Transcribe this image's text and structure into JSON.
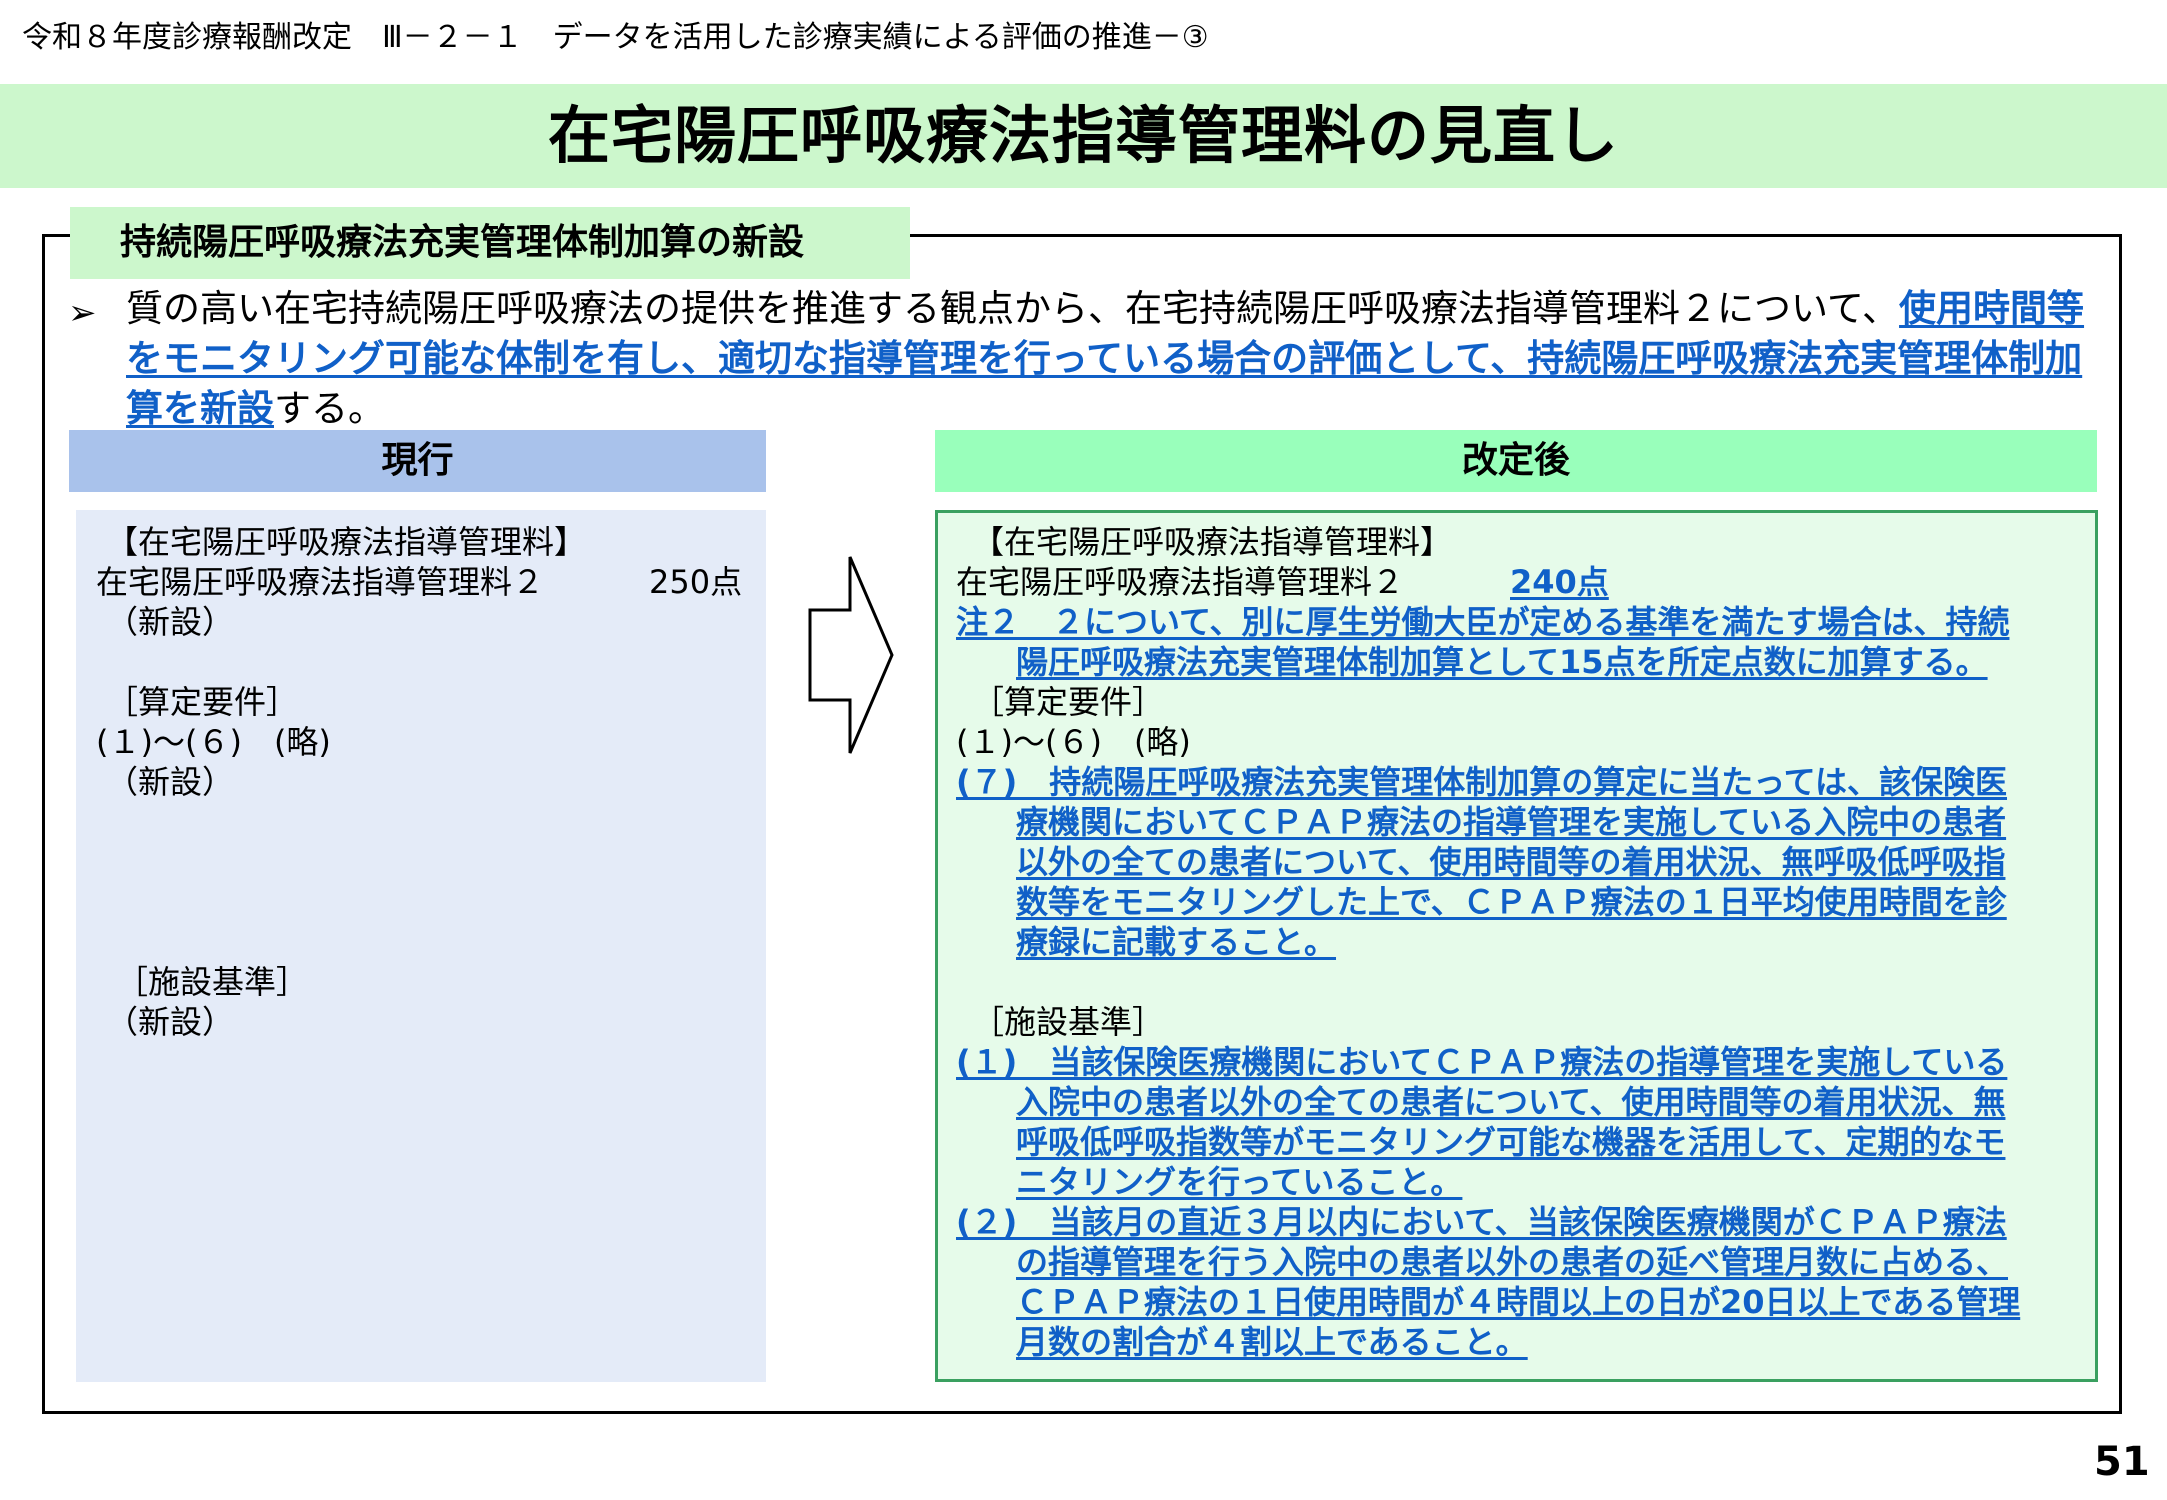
{
  "header": "令和８年度診療報酬改定　Ⅲ－２－１　データを活用した診療実績による評価の推進－③",
  "title": "在宅陽圧呼吸療法指導管理料の見直し",
  "section_title": "持続陽圧呼吸療法充実管理体制加算の新設",
  "summary": {
    "bullet": "➢",
    "text_before": "質の高い在宅持続陽圧呼吸療法の提供を推進する観点から、在宅持続陽圧呼吸療法指導管理料２について、",
    "highlight": "使用時間等をモニタリング可能な体制を有し、適切な指導管理を行っている場合の評価として、持続陽圧呼吸療法充実管理体制加算を新設",
    "text_after": "する。"
  },
  "current": {
    "heading": "現行",
    "lines": {
      "l1": "【在宅陽圧呼吸療法指導管理料】",
      "l2": "在宅陽圧呼吸療法指導管理料２",
      "l2_points": "250点",
      "l3": "（新設）",
      "l4": "［算定要件］",
      "l5": "(１)～(６)　(略)",
      "l6": "（新設）",
      "l7": "［施設基準］",
      "l8": "（新設）"
    }
  },
  "revised": {
    "heading": "改定後",
    "l1": "【在宅陽圧呼吸療法指導管理料】",
    "l2": "在宅陽圧呼吸療法指導管理料２",
    "l2_points": "240点",
    "note2_a": "注２　２について、別に厚生労働大臣が定める基準を満たす場合は、持続",
    "note2_b": "陽圧呼吸療法充実管理体制加算として15点を所定点数に加算する。",
    "req_head": "［算定要件］",
    "req_1_6": "(１)～(６)　(略)",
    "req7_a": "(７)　持続陽圧呼吸療法充実管理体制加算の算定に当たっては、該保険医",
    "req7_b": "療機関においてＣＰＡＰ療法の指導管理を実施している入院中の患者",
    "req7_c": "以外の全ての患者について、使用時間等の着用状況、無呼吸低呼吸指",
    "req7_d": "数等をモニタリングした上で、ＣＰＡＰ療法の１日平均使用時間を診",
    "req7_e": "療録に記載すること。",
    "fac_head": "［施設基準］",
    "fac1_a": "(１)　当該保険医療機関においてＣＰＡＰ療法の指導管理を実施している",
    "fac1_b": "入院中の患者以外の全ての患者について、使用時間等の着用状況、無",
    "fac1_c": "呼吸低呼吸指数等がモニタリング可能な機器を活用して、定期的なモ",
    "fac1_d": "ニタリングを行っていること。",
    "fac2_a": "(２)　当該月の直近３月以内において、当該保険医療機関がＣＰＡＰ療法",
    "fac2_b": "の指導管理を行う入院中の患者以外の患者の延べ管理月数に占める、",
    "fac2_c": "ＣＰＡＰ療法の１日使用時間が４時間以上の日が20日以上である管理",
    "fac2_d": "月数の割合が４割以上であること。"
  },
  "page_number": "51",
  "colors": {
    "title_band": "#ccf7cc",
    "current_header": "#a9c2eb",
    "revised_header": "#99ffbb",
    "highlight_text": "#1060c8"
  }
}
